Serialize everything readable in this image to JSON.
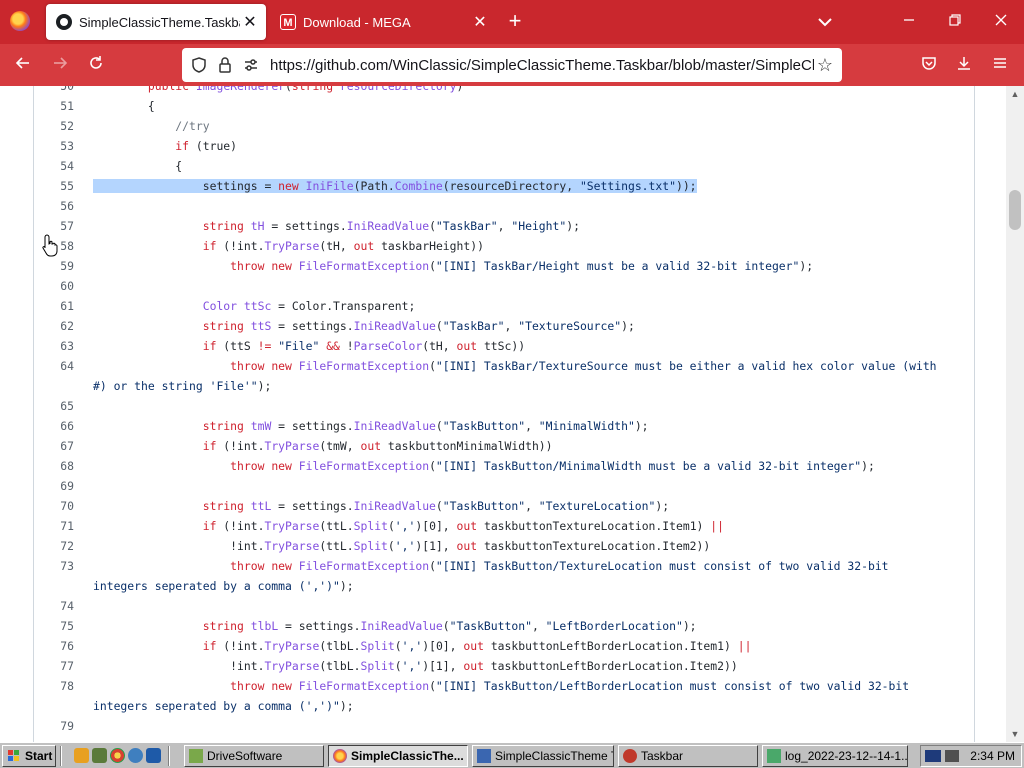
{
  "browser": {
    "tabs": [
      {
        "title": "SimpleClassicTheme.Taskbar/In",
        "close": "✕"
      },
      {
        "title": "Download - MEGA",
        "close": "✕"
      }
    ],
    "new_tab": "+",
    "url": "https://github.com/WinClassic/SimpleClassicTheme.Taskbar/blob/master/SimpleClassicTh"
  },
  "code": {
    "lines": [
      {
        "n": "50",
        "html": "        <span class=\"k\">public</span> <span class=\"t\">ImageRenderer</span>(<span class=\"k\">string</span> <span class=\"t\">resourceDirectory</span>)"
      },
      {
        "n": "51",
        "html": "        {"
      },
      {
        "n": "52",
        "html": "            <span class=\"c\">//try</span>"
      },
      {
        "n": "53",
        "html": "            <span class=\"k\">if</span> (true)"
      },
      {
        "n": "54",
        "html": "            {"
      },
      {
        "n": "55",
        "html": "<span class=\"hl\">                settings = <span class=\"k\">new</span> <span class=\"t\">IniFile</span>(Path.<span class=\"t\">Combine</span>(resourceDirectory, <span class=\"s\">\"Settings.txt\"</span>));</span>"
      },
      {
        "n": "56",
        "html": ""
      },
      {
        "n": "57",
        "html": "                <span class=\"k\">string</span> <span class=\"t\">tH</span> = settings.<span class=\"t\">IniReadValue</span>(<span class=\"s\">\"TaskBar\"</span>, <span class=\"s\">\"Height\"</span>);"
      },
      {
        "n": "58",
        "html": "                <span class=\"k\">if</span> (!int.<span class=\"t\">TryParse</span>(tH, <span class=\"k\">out</span> taskbarHeight))"
      },
      {
        "n": "59",
        "html": "                    <span class=\"k\">throw</span> <span class=\"k\">new</span> <span class=\"t\">FileFormatException</span>(<span class=\"s\">\"[INI] TaskBar/Height must be a valid 32-bit integer\"</span>);"
      },
      {
        "n": "60",
        "html": ""
      },
      {
        "n": "61",
        "html": "                <span class=\"t\">Color</span> <span class=\"t\">ttSc</span> = Color.Transparent;"
      },
      {
        "n": "62",
        "html": "                <span class=\"k\">string</span> <span class=\"t\">ttS</span> = settings.<span class=\"t\">IniReadValue</span>(<span class=\"s\">\"TaskBar\"</span>, <span class=\"s\">\"TextureSource\"</span>);"
      },
      {
        "n": "63",
        "html": "                <span class=\"k\">if</span> (ttS <span class=\"k\">!=</span> <span class=\"s\">\"File\"</span> <span class=\"k\">&amp;&amp;</span> !<span class=\"t\">ParseColor</span>(tH, <span class=\"k\">out</span> ttSc))"
      },
      {
        "n": "64",
        "html": "                    <span class=\"k\">throw</span> <span class=\"k\">new</span> <span class=\"t\">FileFormatException</span>(<span class=\"s\">\"[INI] TaskBar/TextureSource must be either a valid hex color value (with</span>"
      },
      {
        "n": "",
        "html": "<span class=\"s\">#) or the string 'File'\"</span>);"
      },
      {
        "n": "65",
        "html": ""
      },
      {
        "n": "66",
        "html": "                <span class=\"k\">string</span> <span class=\"t\">tmW</span> = settings.<span class=\"t\">IniReadValue</span>(<span class=\"s\">\"TaskButton\"</span>, <span class=\"s\">\"MinimalWidth\"</span>);"
      },
      {
        "n": "67",
        "html": "                <span class=\"k\">if</span> (!int.<span class=\"t\">TryParse</span>(tmW, <span class=\"k\">out</span> taskbuttonMinimalWidth))"
      },
      {
        "n": "68",
        "html": "                    <span class=\"k\">throw</span> <span class=\"k\">new</span> <span class=\"t\">FileFormatException</span>(<span class=\"s\">\"[INI] TaskButton/MinimalWidth must be a valid 32-bit integer\"</span>);"
      },
      {
        "n": "69",
        "html": ""
      },
      {
        "n": "70",
        "html": "                <span class=\"k\">string</span> <span class=\"t\">ttL</span> = settings.<span class=\"t\">IniReadValue</span>(<span class=\"s\">\"TaskButton\"</span>, <span class=\"s\">\"TextureLocation\"</span>);"
      },
      {
        "n": "71",
        "html": "                <span class=\"k\">if</span> (!int.<span class=\"t\">TryParse</span>(ttL.<span class=\"t\">Split</span>(<span class=\"s\">','</span>)[0], <span class=\"k\">out</span> taskbuttonTextureLocation.Item1) <span class=\"k\">||</span>"
      },
      {
        "n": "72",
        "html": "                    !int.<span class=\"t\">TryParse</span>(ttL.<span class=\"t\">Split</span>(<span class=\"s\">','</span>)[1], <span class=\"k\">out</span> taskbuttonTextureLocation.Item2))"
      },
      {
        "n": "73",
        "html": "                    <span class=\"k\">throw</span> <span class=\"k\">new</span> <span class=\"t\">FileFormatException</span>(<span class=\"s\">\"[INI] TaskButton/TextureLocation must consist of two valid 32-bit</span>"
      },
      {
        "n": "",
        "html": "<span class=\"s\">integers seperated by a comma (',')\"</span>);"
      },
      {
        "n": "74",
        "html": ""
      },
      {
        "n": "75",
        "html": "                <span class=\"k\">string</span> <span class=\"t\">tlbL</span> = settings.<span class=\"t\">IniReadValue</span>(<span class=\"s\">\"TaskButton\"</span>, <span class=\"s\">\"LeftBorderLocation\"</span>);"
      },
      {
        "n": "76",
        "html": "                <span class=\"k\">if</span> (!int.<span class=\"t\">TryParse</span>(tlbL.<span class=\"t\">Split</span>(<span class=\"s\">','</span>)[0], <span class=\"k\">out</span> taskbuttonLeftBorderLocation.Item1) <span class=\"k\">||</span>"
      },
      {
        "n": "77",
        "html": "                    !int.<span class=\"t\">TryParse</span>(tlbL.<span class=\"t\">Split</span>(<span class=\"s\">','</span>)[1], <span class=\"k\">out</span> taskbuttonLeftBorderLocation.Item2))"
      },
      {
        "n": "78",
        "html": "                    <span class=\"k\">throw</span> <span class=\"k\">new</span> <span class=\"t\">FileFormatException</span>(<span class=\"s\">\"[INI] TaskButton/LeftBorderLocation must consist of two valid 32-bit</span>"
      },
      {
        "n": "",
        "html": "<span class=\"s\">integers seperated by a comma (',')\"</span>);"
      },
      {
        "n": "79",
        "html": ""
      }
    ]
  },
  "taskbar": {
    "start": "Start",
    "buttons": [
      {
        "label": "DriveSoftware"
      },
      {
        "label": "SimpleClassicThe..."
      },
      {
        "label": "SimpleClassicTheme T..."
      },
      {
        "label": "Taskbar"
      },
      {
        "label": "log_2022-23-12--14-1..."
      }
    ],
    "clock": "2:34 PM"
  }
}
